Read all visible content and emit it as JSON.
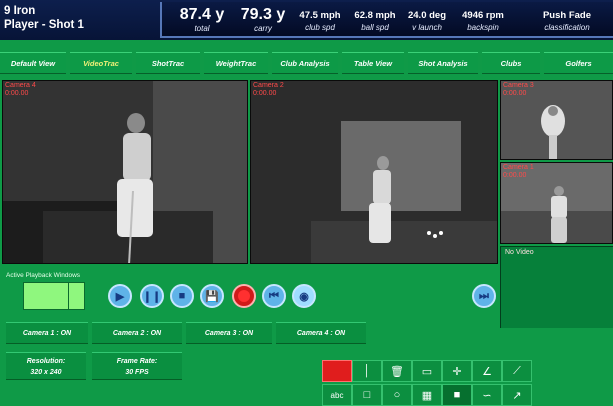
{
  "header": {
    "club": "9 Iron",
    "player_shot": "Player - Shot 1",
    "stats": [
      {
        "value": "87.4 y",
        "label": "total"
      },
      {
        "value": "79.3 y",
        "label": "carry"
      },
      {
        "value": "47.5 mph",
        "label": "club spd"
      },
      {
        "value": "62.8 mph",
        "label": "ball spd"
      },
      {
        "value": "24.0 deg",
        "label": "v launch"
      },
      {
        "value": "4946 rpm",
        "label": "backspin"
      },
      {
        "value": "Push Fade",
        "label": "classification"
      }
    ]
  },
  "nav": {
    "tabs": [
      "Default View",
      "VideoTrac",
      "ShotTrac",
      "WeightTrac",
      "Club Analysis",
      "Table View",
      "Shot Analysis",
      "Clubs",
      "Golfers"
    ],
    "active_tab": "VideoTrac"
  },
  "cameras": [
    {
      "label": "Camera 4",
      "time": "0:00.00"
    },
    {
      "label": "Camera 2",
      "time": "0:00.00"
    },
    {
      "label": "Camera 3",
      "time": "0:00.00"
    },
    {
      "label": "Camera 1",
      "time": "0:00.00"
    }
  ],
  "no_video": "No Video",
  "playback": {
    "label": "Active Playback Windows",
    "controls": [
      "play-icon",
      "pause-icon",
      "stop-icon",
      "save-icon",
      "record-icon",
      "skip-back-icon",
      "cursor-icon",
      "skip-forward-icon"
    ]
  },
  "camera_status": [
    "Camera 1 : ON",
    "Camera 2 : ON",
    "Camera 3 : ON",
    "Camera 4 : ON"
  ],
  "resolution": {
    "label": "Resolution:",
    "value": "320 x 240"
  },
  "frame_rate": {
    "label": "Frame Rate:",
    "value": "30 FPS"
  },
  "colors": {
    "background": "#0f9a47",
    "header": "#071437",
    "accent_red": "#e01d1d",
    "active_tab_text": "#f1f078"
  },
  "toolbar": {
    "tools": [
      "color-swatch",
      "line-width-icon",
      "trash-icon",
      "eraser-icon",
      "move-icon",
      "angle-icon",
      "line-icon",
      "text-icon",
      "rectangle-icon",
      "circle-icon",
      "grid-icon",
      "fill-icon",
      "curve-icon",
      "arrow-icon"
    ],
    "text_tool_label": "abc"
  }
}
